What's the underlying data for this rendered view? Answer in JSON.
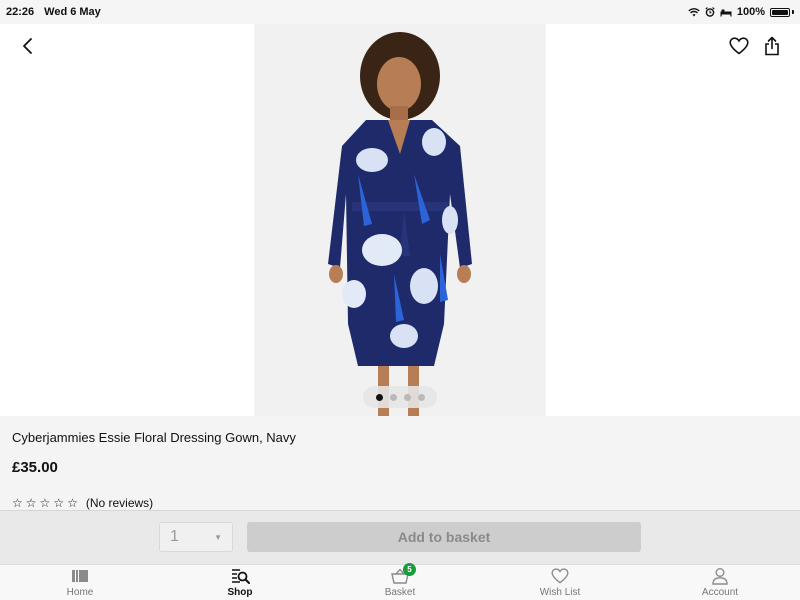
{
  "status_bar": {
    "time": "22:26",
    "date": "Wed 6 May",
    "battery": "100%",
    "battery_level": 1.0
  },
  "hero": {
    "image_alt": "Woman wearing navy floral dressing gown",
    "current_image": 1,
    "image_count": 4,
    "icons": [
      "back-arrow-icon",
      "heart-icon",
      "share-icon"
    ]
  },
  "product": {
    "title": "Cyberjammies Essie Floral Dressing Gown, Navy",
    "price": "£35.00",
    "rating_stars": 0,
    "max_stars": 5,
    "reviews_text": "(No reviews)"
  },
  "buy_bar": {
    "quantity": "1",
    "add_label": "Add to basket"
  },
  "tabs": [
    {
      "label": "Home",
      "icon": "home-icon",
      "active": false
    },
    {
      "label": "Shop",
      "icon": "shop-search-icon",
      "active": true
    },
    {
      "label": "Basket",
      "icon": "basket-icon",
      "active": false,
      "badge": "5"
    },
    {
      "label": "Wish List",
      "icon": "heart-icon",
      "active": false
    },
    {
      "label": "Account",
      "icon": "person-icon",
      "active": false
    }
  ],
  "colors": {
    "badge": "#1a9b3c",
    "gown_navy": "#1f2a6b",
    "disabled_button": "#cdcdcd"
  }
}
